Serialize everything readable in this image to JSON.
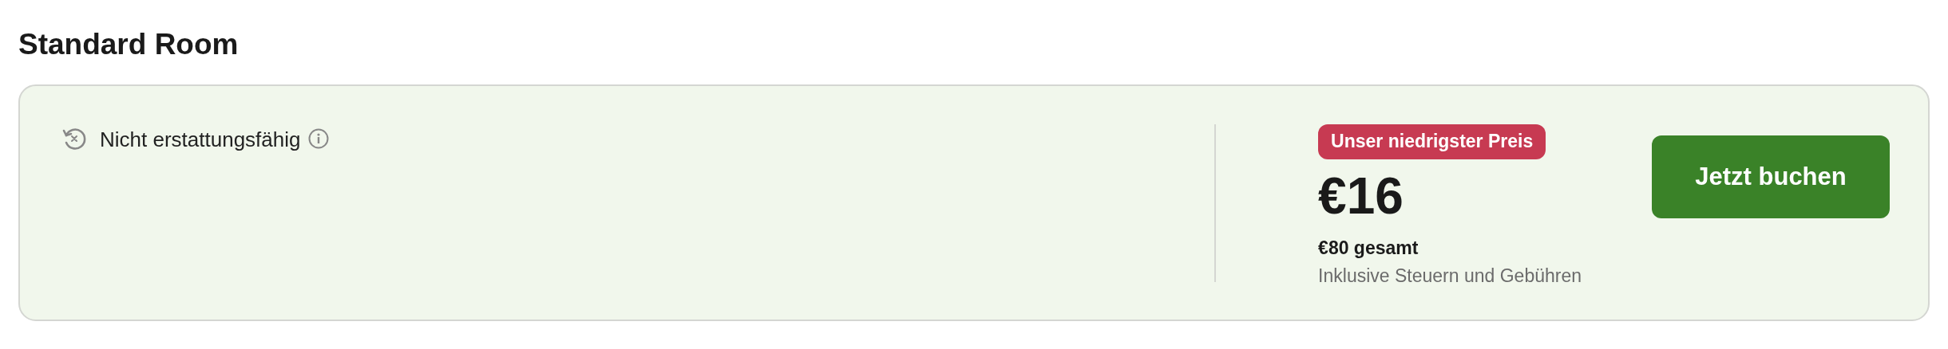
{
  "title": "Standard Room",
  "offer": {
    "policy": "Nicht erstattungsfähig",
    "badge": "Unser niedrigster Preis",
    "price": "€16",
    "total": "€80 gesamt",
    "note": "Inklusive Steuern und Gebühren",
    "button": "Jetzt buchen"
  }
}
